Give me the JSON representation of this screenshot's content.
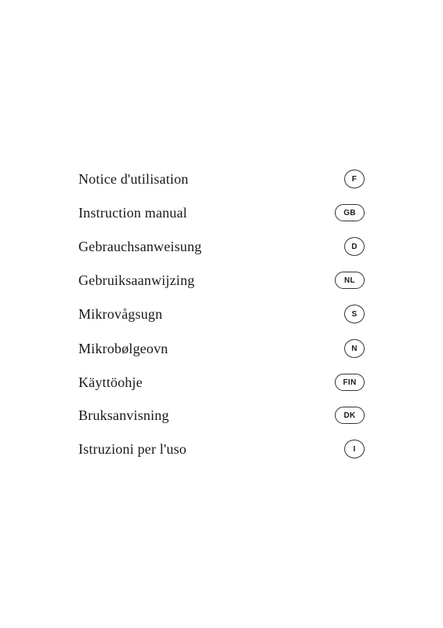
{
  "menu": {
    "items": [
      {
        "label": "Notice d'utilisation",
        "badge": "F",
        "badge_type": "single"
      },
      {
        "label": "Instruction manual",
        "badge": "GB",
        "badge_type": "wide"
      },
      {
        "label": "Gebrauchsanweisung",
        "badge": "D",
        "badge_type": "single"
      },
      {
        "label": "Gebruiksaanwijzing",
        "badge": "NL",
        "badge_type": "wide"
      },
      {
        "label": "Mikrovågsugn",
        "badge": "S",
        "badge_type": "single"
      },
      {
        "label": "Mikrobølgeovn",
        "badge": "N",
        "badge_type": "single"
      },
      {
        "label": "Käyttöohje",
        "badge": "FIN",
        "badge_type": "wide"
      },
      {
        "label": "Bruksanvisning",
        "badge": "DK",
        "badge_type": "wide"
      },
      {
        "label": "Istruzioni per l'uso",
        "badge": "I",
        "badge_type": "single"
      }
    ]
  }
}
